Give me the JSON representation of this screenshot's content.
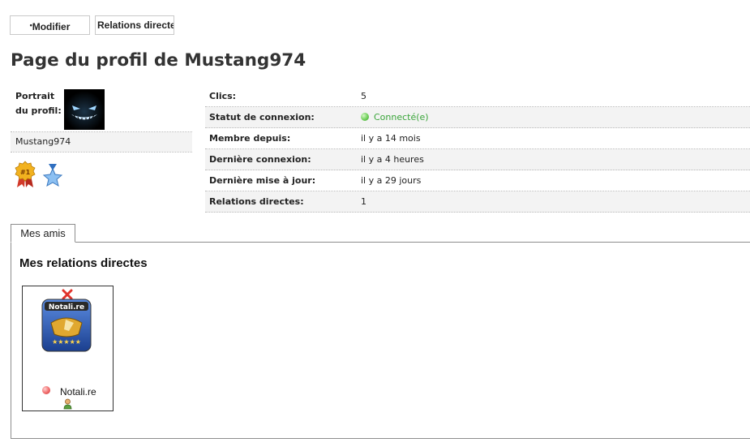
{
  "toolbar": {
    "modify_label": "Modifier",
    "relations_label": "Relations directe"
  },
  "page": {
    "title": "Page du profil de Mustang974"
  },
  "profile": {
    "portrait_label": "Portrait du profil:",
    "username": "Mustang974",
    "avatar_icon": "grinning-face-avatar",
    "badges": [
      "rank-1-medal-icon",
      "blue-star-icon"
    ]
  },
  "info": {
    "rows": [
      {
        "label": "Clics:",
        "value": "5"
      },
      {
        "label": "Statut de connexion:",
        "value": "Connecté(e)"
      },
      {
        "label": "Membre depuis:",
        "value": "il y a 14 mois"
      },
      {
        "label": "Dernière connexion:",
        "value": "il y a 4 heures"
      },
      {
        "label": "Dernière mise à jour:",
        "value": "il y a 29 jours"
      },
      {
        "label": "Relations directes:",
        "value": "1"
      }
    ]
  },
  "tabs": [
    {
      "label": "Mes amis"
    }
  ],
  "friends": {
    "title": "Mes relations directes",
    "items": [
      {
        "name": "Notali.re",
        "status": "offline"
      }
    ]
  },
  "colors": {
    "online": "#3aa53a",
    "offline": "#e05050",
    "border": "#8d8d8d"
  }
}
